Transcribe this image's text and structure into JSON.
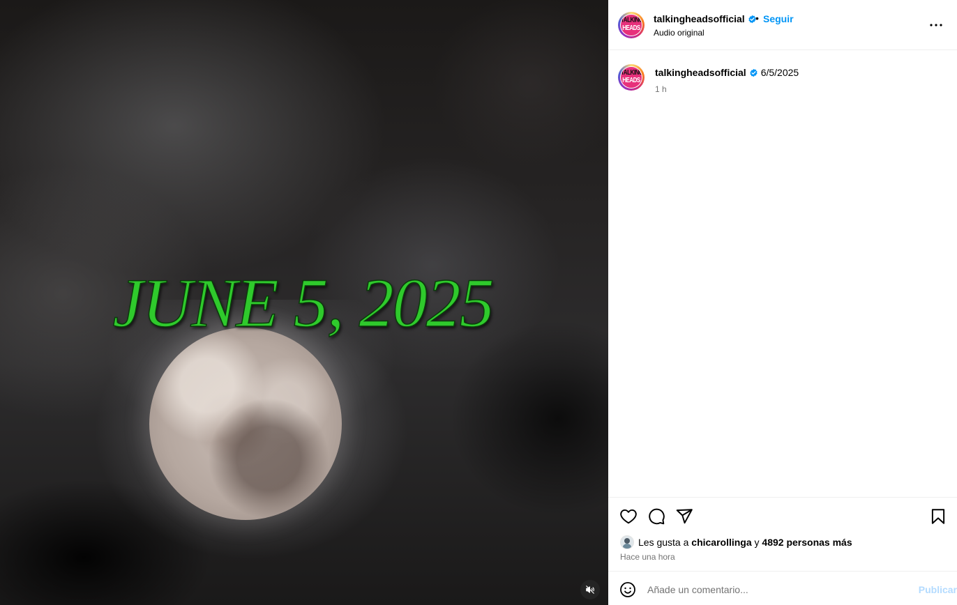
{
  "media": {
    "headline": "JUNE 5, 2025",
    "mute_icon": "speaker-muted-icon"
  },
  "header": {
    "username": "talkingheadsofficial",
    "verified_icon": "verified-badge-icon",
    "separator": "•",
    "follow_label": "Seguir",
    "audio_label": "Audio original",
    "more_icon": "more-options-icon",
    "avatar": {
      "line1": "TALKING",
      "line2": "HEADS"
    }
  },
  "caption": {
    "username": "talkingheadsofficial",
    "text": "6/5/2025",
    "time": "1 h"
  },
  "actions": {
    "like_icon": "heart-icon",
    "comment_icon": "comment-icon",
    "share_icon": "share-icon",
    "save_icon": "bookmark-icon"
  },
  "likes": {
    "prefix": "Les gusta a",
    "user": "chicarollinga",
    "connector": "y",
    "others": "4892 personas más",
    "when": "Hace una hora"
  },
  "comment": {
    "emoji_icon": "emoji-icon",
    "placeholder": "Añade un comentario...",
    "publish_label": "Publicar"
  },
  "colors": {
    "accent": "#0095f6",
    "headline_green": "#2fca2c",
    "muted_text": "#737373",
    "publish_disabled": "#b3dbff"
  }
}
